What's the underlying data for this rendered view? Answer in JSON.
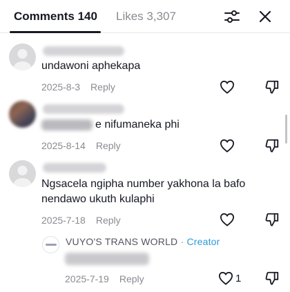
{
  "tabs": {
    "comments_label": "Comments 140",
    "likes_label": "Likes 3,307"
  },
  "icons": {
    "filter": "sliders-icon",
    "close": "close-icon",
    "like": "heart-outline-icon",
    "dislike": "thumbs-down-icon"
  },
  "comments": [
    {
      "text": "undawoni aphekapa",
      "date": "2025-8-3",
      "reply_label": "Reply"
    },
    {
      "text": "e nifumaneka phi",
      "date": "2025-8-14",
      "reply_label": "Reply"
    },
    {
      "text_line1": "Ngsacela ngipha number yakhona la bafo",
      "text_line2": "nendawo ukuth kulaphi",
      "date": "2025-7-18",
      "reply_label": "Reply"
    }
  ],
  "creator_reply": {
    "author": "VUYO'S TRANS WORLD",
    "separator": "·",
    "badge": "Creator",
    "date": "2025-7-19",
    "reply_label": "Reply",
    "like_count": "1"
  },
  "colors": {
    "text": "#161823",
    "secondary": "#8a8b91",
    "creator_badge": "#2c9ad8"
  }
}
